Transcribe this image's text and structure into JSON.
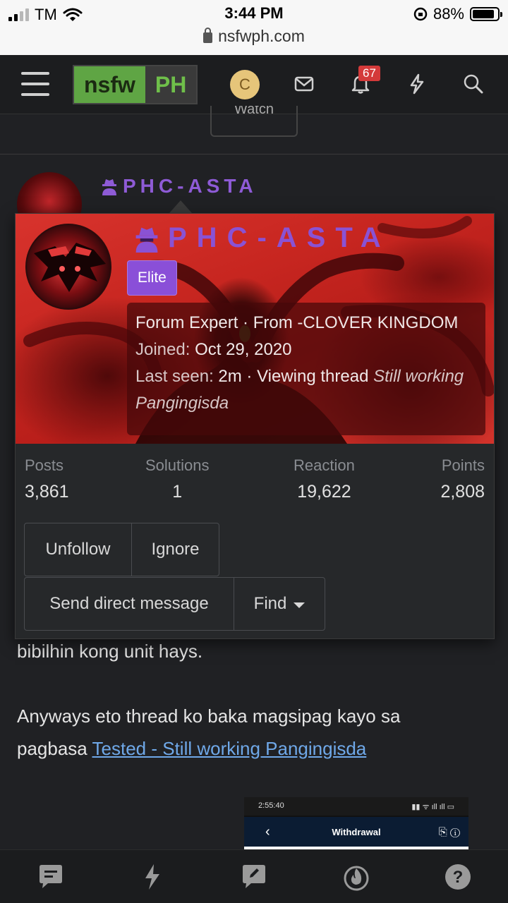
{
  "status_bar": {
    "carrier": "TM",
    "time": "3:44 PM",
    "battery": "88%",
    "battery_level": 0.88,
    "url": "nsfwph.com"
  },
  "header": {
    "logo_left": "nsfw",
    "logo_right": "PH",
    "avatar_letter": "C",
    "alerts_badge": "67"
  },
  "behind": {
    "watch_label": "Watch",
    "post_author": "PHC-ASTA"
  },
  "card": {
    "username": "PHC-ASTA",
    "banner": "Elite",
    "title_line": "Forum Expert · From -CLOVER KINGDOM",
    "joined_label": "Joined:",
    "joined_value": "Oct 29, 2020",
    "last_seen_label": "Last seen:",
    "last_seen_value": "2m · Viewing thread",
    "last_seen_thread": "Still working Pangingisda",
    "stats": [
      {
        "label": "Posts",
        "value": "3,861"
      },
      {
        "label": "Solutions",
        "value": "1"
      },
      {
        "label": "Reaction",
        "value": "19,622"
      },
      {
        "label": "Points",
        "value": "2,808"
      }
    ],
    "buttons": {
      "unfollow": "Unfollow",
      "ignore": "Ignore",
      "send_dm": "Send direct message",
      "find": "Find"
    }
  },
  "post": {
    "line1": "bibilhin kong unit hays.",
    "line2": "Anyways eto thread ko baka magsipag kayo sa",
    "line3_prefix": "pagbasa ",
    "link": "Tested - Still working Pangingisda"
  },
  "embed": {
    "time": "2:55:40",
    "title": "Withdrawal"
  },
  "colors": {
    "accent_purple": "#8a4fd8",
    "logo_green": "#5fa544",
    "badge_red": "#d43a3a",
    "link_blue": "#6fa8e8"
  },
  "tab_icons": [
    "chat-icon",
    "lightning-icon",
    "edit-icon",
    "fire-icon",
    "help-icon"
  ]
}
